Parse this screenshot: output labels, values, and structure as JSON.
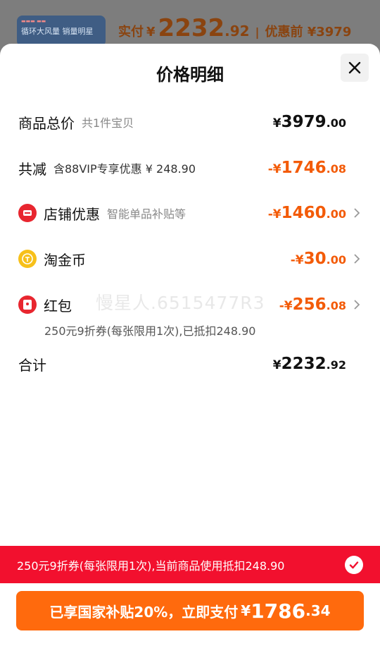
{
  "background": {
    "thumb_text": "循环大风量 销量明星",
    "pay_label": "实付",
    "pay_currency": "¥",
    "pay_integer": "2232",
    "pay_decimal": ".92",
    "separator": "|",
    "before_label": "优惠前 ¥3979"
  },
  "sheet": {
    "title": "价格明细",
    "close_icon": "close-icon"
  },
  "rows": {
    "total": {
      "label": "商品总价",
      "sub": "共1件宝贝",
      "currency": "¥",
      "integer": "3979",
      "decimal": ".00"
    },
    "reduce": {
      "label": "共减",
      "sub": "含88VIP专享优惠 ¥ 248.90",
      "currency": "-¥",
      "integer": "1746",
      "decimal": ".08"
    },
    "shop": {
      "icon": "shop-icon",
      "label": "店铺优惠",
      "sub": "智能单品补贴等",
      "currency": "-¥",
      "integer": "1460",
      "decimal": ".00"
    },
    "coin": {
      "icon": "coin-icon",
      "label": "淘金币",
      "currency": "-¥",
      "integer": "30",
      "decimal": ".00"
    },
    "redpacket": {
      "icon": "red-packet-icon",
      "label": "红包",
      "currency": "-¥",
      "integer": "256",
      "decimal": ".08",
      "note": "250元9折券(每张限用1次),已抵扣248.90"
    },
    "sum": {
      "label": "合计",
      "currency": "¥",
      "integer": "2232",
      "decimal": ".92"
    }
  },
  "watermark": "慢星人.6515477R3",
  "coupon_bar": {
    "text": "250元9折券(每张限用1次),当前商品使用抵扣248.90"
  },
  "cta": {
    "text": "已享国家补贴20%，立即支付",
    "currency": "¥",
    "integer": "1786",
    "decimal": ".34"
  },
  "colors": {
    "orange": "#f35b08",
    "red_bar": "#f2102e",
    "button": "#ff6a0d"
  }
}
